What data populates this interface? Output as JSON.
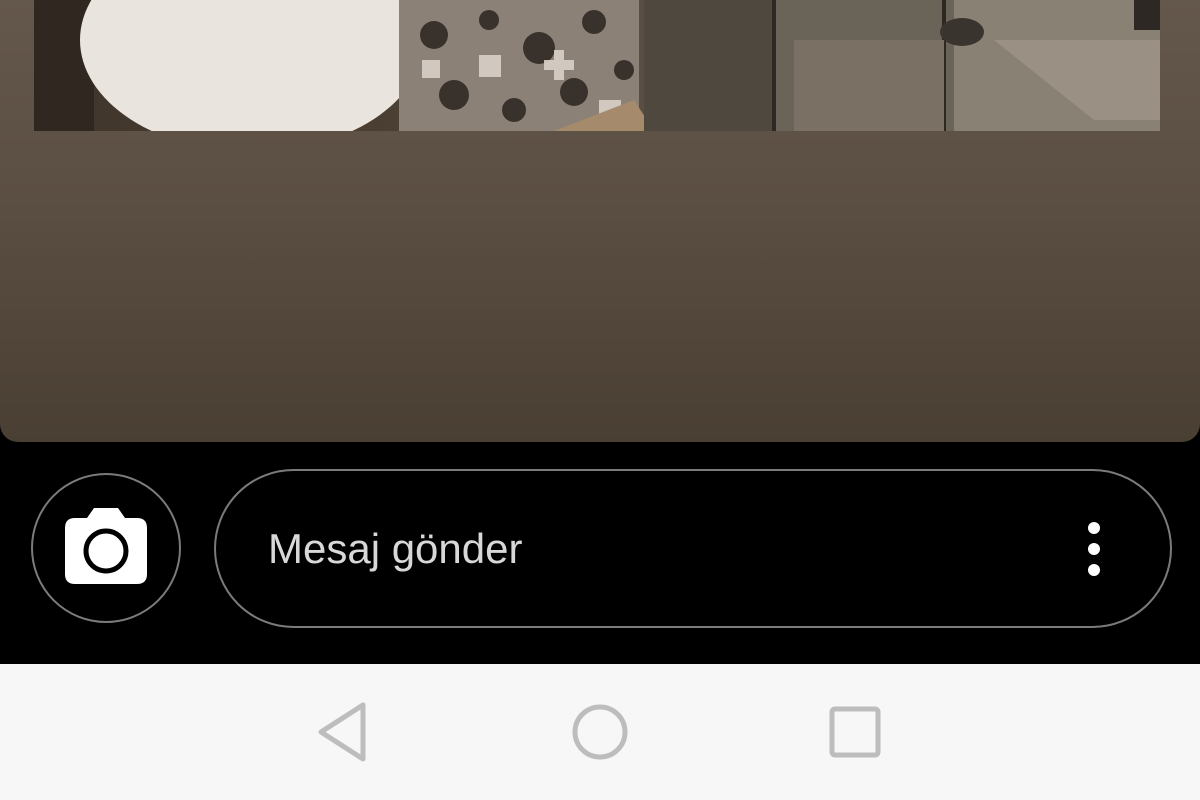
{
  "story": {
    "media": "story-photo"
  },
  "composer": {
    "camera_icon": "camera-icon",
    "message_placeholder": "Mesaj gönder",
    "message_value": "",
    "more_icon": "more-vertical-icon"
  },
  "navigation": {
    "back_icon": "back-triangle-icon",
    "home_icon": "home-circle-icon",
    "recents_icon": "recents-square-icon"
  },
  "colors": {
    "story_background": "#5b4e42",
    "composer_background": "#000000",
    "outline": "#7b7b7b",
    "placeholder_text": "#d8d8d8",
    "nav_background": "#f7f7f7",
    "nav_icon": "#bdbdbd"
  }
}
